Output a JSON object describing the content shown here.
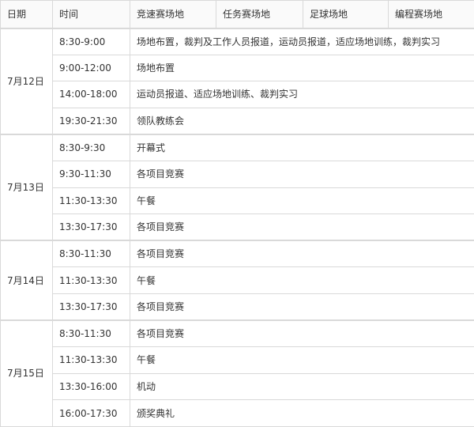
{
  "headers": {
    "date": "日期",
    "time": "时间",
    "venues": [
      "竞速赛场地",
      "任务赛场地",
      "足球场地",
      "编程赛场地"
    ]
  },
  "days": [
    {
      "date": "7月12日",
      "slots": [
        {
          "time": "8:30-9:00",
          "activity": "场地布置，裁判及工作人员报道，运动员报道，适应场地训练，裁判实习"
        },
        {
          "time": "9:00-12:00",
          "activity": "场地布置"
        },
        {
          "time": "14:00-18:00",
          "activity": "运动员报道、适应场地训练、裁判实习"
        },
        {
          "time": "19:30-21:30",
          "activity": "领队教练会"
        }
      ]
    },
    {
      "date": "7月13日",
      "slots": [
        {
          "time": "8:30-9:30",
          "activity": "开幕式"
        },
        {
          "time": "9:30-11:30",
          "activity": "各项目竞赛"
        },
        {
          "time": "11:30-13:30",
          "activity": "午餐"
        },
        {
          "time": "13:30-17:30",
          "activity": "各项目竞赛"
        }
      ]
    },
    {
      "date": "7月14日",
      "slots": [
        {
          "time": "8:30-11:30",
          "activity": "各项目竞赛"
        },
        {
          "time": "11:30-13:30",
          "activity": "午餐"
        },
        {
          "time": "13:30-17:30",
          "activity": "各项目竞赛"
        }
      ]
    },
    {
      "date": "7月15日",
      "slots": [
        {
          "time": "8:30-11:30",
          "activity": "各项目竞赛"
        },
        {
          "time": "11:30-13:30",
          "activity": "午餐"
        },
        {
          "time": "13:30-16:00",
          "activity": "机动"
        },
        {
          "time": "16:00-17:30",
          "activity": "颁奖典礼"
        }
      ]
    }
  ]
}
